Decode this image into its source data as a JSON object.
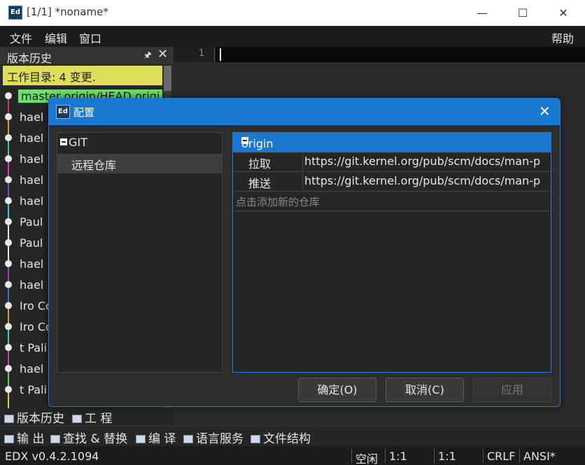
{
  "window": {
    "title": "[1/1] *noname*",
    "icon_label": "Ed"
  },
  "menu": {
    "file": "文件",
    "edit": "编辑",
    "window": "窗口",
    "help": "帮助"
  },
  "history_panel": {
    "title": "版本历史",
    "workdir": "工作目录: 4 变更.",
    "rows": [
      {
        "author": "master origin/HEAD origi",
        "line_color": "#d43c3c"
      },
      {
        "author": "hael",
        "line_color": "#d4a03c"
      },
      {
        "author": "hael",
        "line_color": "#3cd46e"
      },
      {
        "author": "hael",
        "line_color": "#d43cc8"
      },
      {
        "author": "hael",
        "line_color": "#5a5ad4"
      },
      {
        "author": "hael",
        "line_color": "#3cc8d4"
      },
      {
        "author": "Paul",
        "line_color": "#e6e6e6"
      },
      {
        "author": "Paul",
        "line_color": "#e6e6e6"
      },
      {
        "author": "hael",
        "line_color": "#a03cd4"
      },
      {
        "author": "hael",
        "line_color": "#3c6ed4"
      },
      {
        "author": "Iro Co",
        "line_color": "#d4a03c"
      },
      {
        "author": "Iro Co",
        "line_color": "#3cd4a0"
      },
      {
        "author": "t Pali",
        "line_color": "#d43c9a"
      },
      {
        "author": "hael",
        "line_color": "#6ed43c"
      },
      {
        "author": "t Pali",
        "line_color": "#d4d43c"
      }
    ]
  },
  "editor": {
    "line_number": "1"
  },
  "bottom_tabs_upper": [
    {
      "label": "版本历史"
    },
    {
      "label": "工 程"
    }
  ],
  "bottom_tabs_lower": [
    {
      "label": "输 出"
    },
    {
      "label": "查找 & 替换"
    },
    {
      "label": "编 译"
    },
    {
      "label": "语言服务"
    },
    {
      "label": "文件结构"
    }
  ],
  "status": {
    "version": "EDX v0.4.2.1094",
    "state": "空闲",
    "pos1": "1:1",
    "pos2": "1:1",
    "eol": "CRLF",
    "encoding": "ANSI*"
  },
  "dialog": {
    "title": "配置",
    "icon_label": "Ed",
    "tree": {
      "root": "GIT",
      "child": "远程仓库"
    },
    "remote": {
      "name": "origin",
      "fetch_label": "拉取",
      "fetch_url": "https://git.kernel.org/pub/scm/docs/man-p",
      "push_label": "推送",
      "push_url": "https://git.kernel.org/pub/scm/docs/man-p",
      "add_placeholder": "点击添加新的仓库"
    },
    "buttons": {
      "ok": "确定(O)",
      "cancel": "取消(C)",
      "apply": "应用"
    }
  }
}
